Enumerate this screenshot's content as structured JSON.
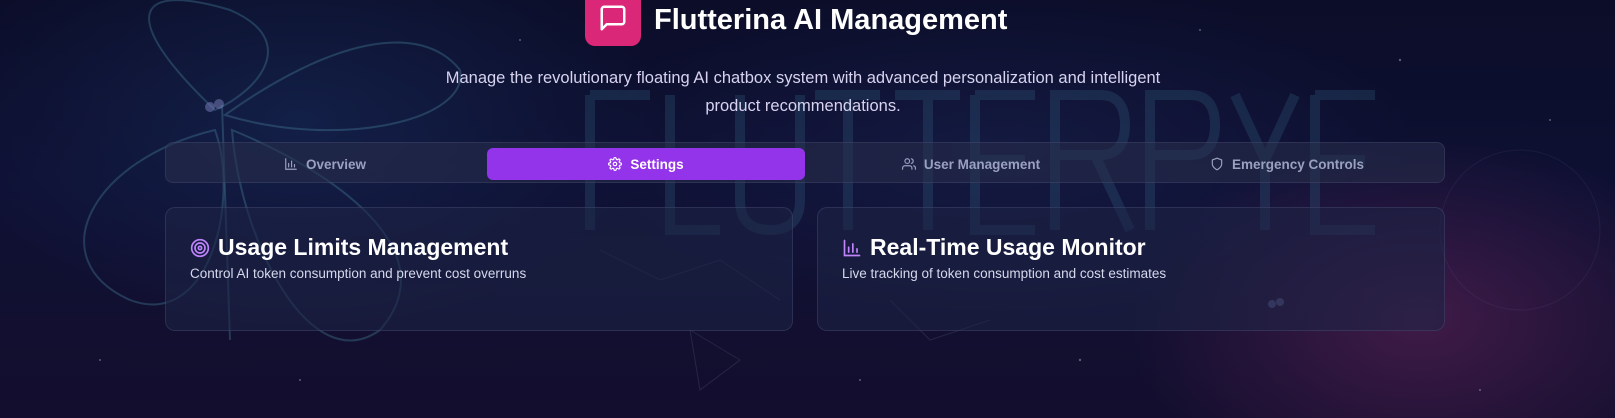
{
  "header": {
    "title": "Flutterina AI Management",
    "subtitle": "Manage the revolutionary floating AI chatbox system with advanced personalization and intelligent product recommendations.",
    "logo_icon": "message-square-icon",
    "logo_color": "#db2777"
  },
  "tabs": [
    {
      "label": "Overview",
      "icon": "bar-chart-icon",
      "active": false
    },
    {
      "label": "Settings",
      "icon": "gear-icon",
      "active": true
    },
    {
      "label": "User Management",
      "icon": "users-icon",
      "active": false
    },
    {
      "label": "Emergency Controls",
      "icon": "shield-icon",
      "active": false
    }
  ],
  "cards": [
    {
      "title": "Usage Limits Management",
      "description": "Control AI token consumption and prevent cost overruns",
      "icon": "target-icon"
    },
    {
      "title": "Real-Time Usage Monitor",
      "description": "Live tracking of token consumption and cost estimates",
      "icon": "bar-chart-icon"
    }
  ],
  "colors": {
    "accent": "#9333ea",
    "icon_accent": "#c084fc",
    "background": "#121540"
  }
}
